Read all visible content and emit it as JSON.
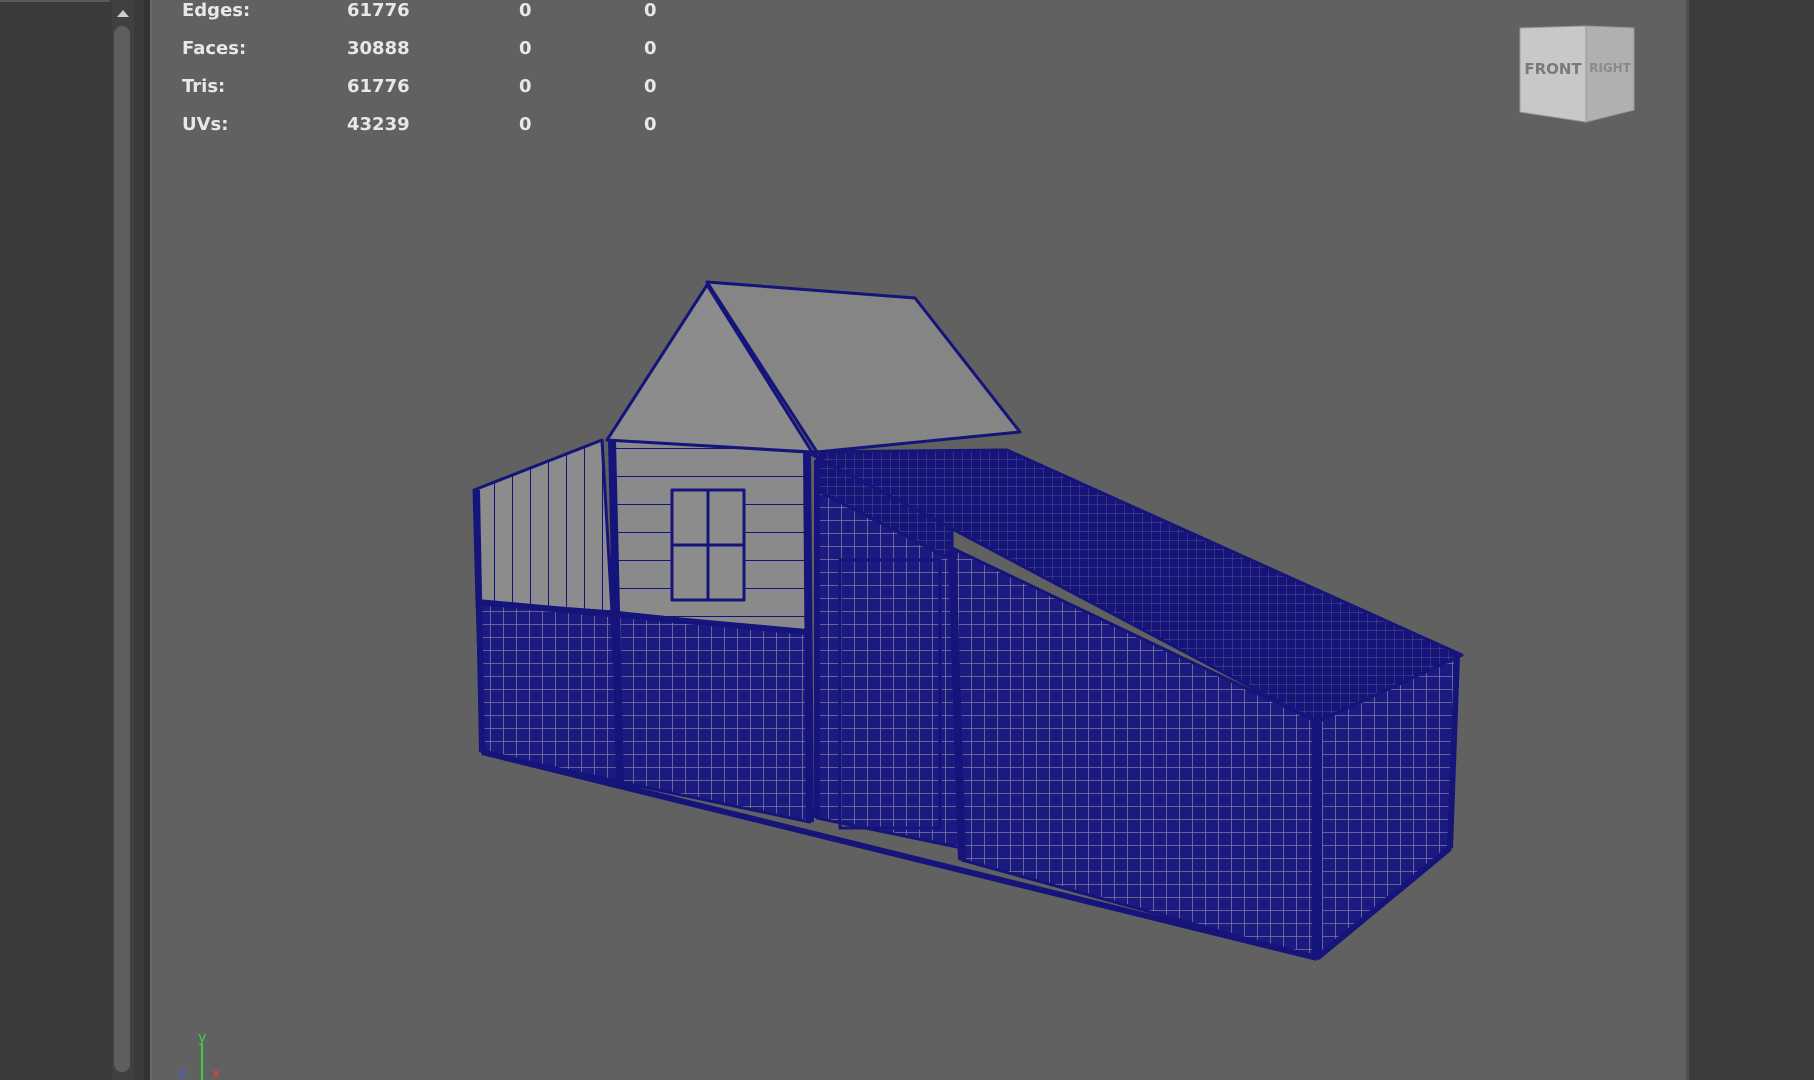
{
  "hud": {
    "rows": [
      {
        "label": "Edges:",
        "v1": "61776",
        "v2": "0",
        "v3": "0"
      },
      {
        "label": "Faces:",
        "v1": "30888",
        "v2": "0",
        "v3": "0"
      },
      {
        "label": "Tris:",
        "v1": "61776",
        "v2": "0",
        "v3": "0"
      },
      {
        "label": "UVs:",
        "v1": "43239",
        "v2": "0",
        "v3": "0"
      }
    ]
  },
  "viewcube": {
    "front": "FRONT",
    "right": "RIGHT"
  },
  "axis": {
    "y": "y",
    "z": "z",
    "x": "x"
  },
  "colors": {
    "viewport_bg": "#616161",
    "wire": "#14147a",
    "mesh_fill": "#8c8c8c",
    "axis_y": "#40d040",
    "axis_x": "#e04040",
    "axis_z": "#4060e0"
  }
}
